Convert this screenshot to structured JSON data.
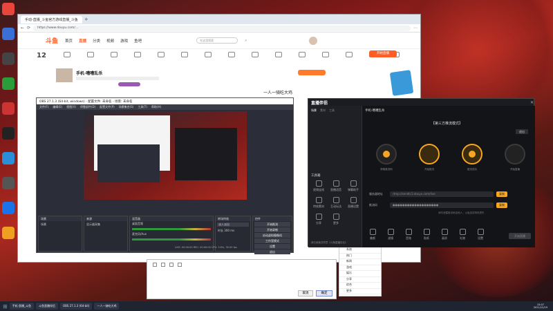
{
  "desktop_icons": [
    {
      "label": "",
      "color": "#e8453c"
    },
    {
      "label": "",
      "color": "#3a6fd8"
    },
    {
      "label": "",
      "color": "#444"
    },
    {
      "label": "",
      "color": "#2a9d3a"
    },
    {
      "label": "",
      "color": "#c33"
    },
    {
      "label": "",
      "color": "#222"
    },
    {
      "label": "",
      "color": "#2a8fd8"
    },
    {
      "label": "",
      "color": "#555"
    },
    {
      "label": "",
      "color": "#1a73e8"
    },
    {
      "label": "",
      "color": "#f0a020"
    }
  ],
  "browser": {
    "tab_label": "手动-直播_斗鱼官方游戏直播_斗鱼",
    "url": "https://www.douyu.com/... ",
    "logo": "斗鱼",
    "nav": [
      "首页",
      "直播",
      "分类",
      "视频",
      "游戏",
      "鱼吧"
    ],
    "search_placeholder": "在这里搜索",
    "streamer_name": "手机·嘈嘈乱杀",
    "room_title": "一人一骑吃大鸡",
    "stats": "12",
    "btn_start": "开始直播",
    "chat_lines": [
      "…",
      "…",
      "…",
      "…",
      "…",
      "…",
      "…",
      "…",
      "…",
      "…",
      "…",
      "…"
    ]
  },
  "obs": {
    "title": "OBS 27.1.3 (64-bit, windows) - 配置文件: 未命名 - 场景: 未命名",
    "menu": [
      "文件(F)",
      "编辑(E)",
      "视图(V)",
      "停靠部件(D)",
      "配置文件(P)",
      "场景集合(S)",
      "工具(T)",
      "帮助(H)"
    ],
    "docks": {
      "scenes": "场景",
      "sources": "来源",
      "mixer": "混音器",
      "transitions": "转场特效",
      "controls": "控件"
    },
    "scene_item": "场景",
    "source_item": "显示器采集",
    "mixer_tracks": [
      "桌面音频",
      "麦克风/Aux"
    ],
    "transition_value": "淡入淡出",
    "duration_label": "时长",
    "duration_value": "300 ms",
    "control_buttons": [
      "开始推流",
      "开始录制",
      "启动虚拟摄像机",
      "工作室模式",
      "设置",
      "退出"
    ],
    "status": "LIVE: 00:00:00  REC: 00:00:00  CPU: 3.6%, 30.00 fps"
  },
  "live": {
    "logo": "直播伴侣",
    "left_tabs": [
      "场景",
      "素材",
      "工具"
    ],
    "tools_title": "工具箱",
    "tools": [
      "视频连线",
      "直播语音",
      "弹幕助手",
      "特效素材",
      "互动玩法",
      "直播设置",
      "分享",
      "更多"
    ],
    "streamer": "手机·嘈嘈乱杀",
    "page_title": "【第三方推流模式】",
    "back_btn": "退出",
    "steps": [
      "获取推流码",
      "开始推流",
      "推流成功",
      "开始直播"
    ],
    "fields": [
      {
        "label": "服务器地址",
        "value": "rtmp://sendtc3.douyu.com/live",
        "btn": "复制"
      },
      {
        "label": "推流码",
        "value": "●●●●●●●●●●●●●●●●●●●",
        "btn": "复制"
      }
    ],
    "hint": "请勿泄露推流码给他人，以免给您带来损失",
    "bottom_tools": [
      "美颜",
      "滤镜",
      "音效",
      "贴纸",
      "画质",
      "礼物",
      "设置"
    ],
    "start_btn": "开始直播",
    "agree": "我已阅读并同意《斗鱼直播协议》"
  },
  "popup": {
    "title": "一人一骑吃大鸡",
    "cancel": "取消",
    "confirm": "确定"
  },
  "list_panel": [
    "系统",
    "热门",
    "新闻",
    "游戏",
    "娱乐",
    "分享",
    "综合",
    "更多"
  ],
  "taskbar": {
    "items": [
      "手机·直播_斗鱼",
      "斗鱼直播伴侣",
      "OBS 27.1.3 (64-bit)",
      "一人一骑吃大鸡"
    ],
    "time": "15:07",
    "date": "2021/12/19"
  }
}
